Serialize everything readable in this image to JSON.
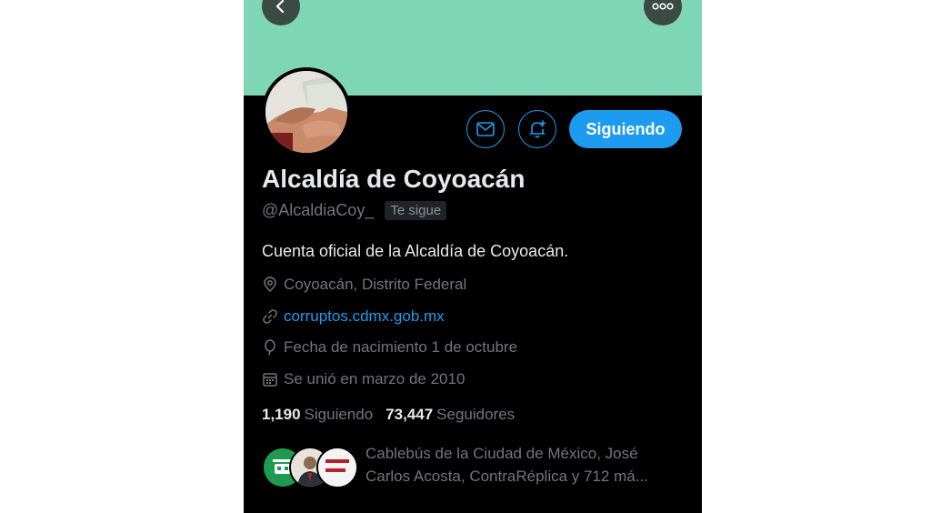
{
  "header": {
    "back_icon": "chevron-left-icon",
    "more_icon": "ellipsis-icon",
    "banner_color": "#7fd6b6"
  },
  "profile": {
    "name": "Alcaldía de Coyoacán",
    "handle": "@AlcaldiaCoy_",
    "follows_you": "Te sigue",
    "bio": "Cuenta oficial de la Alcaldía de Coyoacán.",
    "location": "Coyoacán, Distrito Federal",
    "website": "corruptos.cdmx.gob.mx",
    "birthday": "Fecha de nacimiento 1 de octubre",
    "joined": "Se unió en marzo de 2010"
  },
  "actions": {
    "message_icon": "envelope-icon",
    "notify_icon": "bell-plus-icon",
    "follow_label": "Siguiendo"
  },
  "stats": {
    "following_count": "1,190",
    "following_label": "Siguiendo",
    "followers_count": "73,447",
    "followers_label": "Seguidores"
  },
  "followers_you_know": {
    "line1": "Cablebús de la Ciudad de México, José",
    "line2": "Carlos Acosta, ContraRéplica y 712 má..."
  },
  "colors": {
    "accent": "#1d9bf0",
    "background": "#000000",
    "text_primary": "#e7e9ea",
    "text_secondary": "#71767b"
  }
}
